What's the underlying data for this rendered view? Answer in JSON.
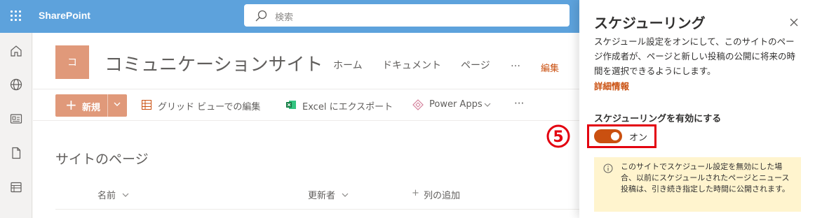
{
  "app": {
    "name": "SharePoint",
    "search_placeholder": "検索"
  },
  "site": {
    "logo_letter": "コ",
    "title": "コミュニケーションサイト",
    "nav": [
      "ホーム",
      "ドキュメント",
      "ページ",
      "…"
    ],
    "edit_label": "編集"
  },
  "commandbar": {
    "new_label": "新規",
    "grid_edit": "グリッド ビューでの編集",
    "excel_export": "Excel にエクスポート",
    "power_apps": "Power Apps",
    "more": "···"
  },
  "list": {
    "heading": "サイトのページ",
    "columns": {
      "name": "名前",
      "modified_by": "更新者",
      "add_column": "列の追加"
    }
  },
  "panel": {
    "title": "スケジューリング",
    "description": "スケジュール設定をオンにして、このサイトのページ作成者が、ページと新しい投稿の公開に将来の時間を選択できるようにします。",
    "link": "詳細情報",
    "toggle_label": "スケジューリングを有効にする",
    "toggle_state": "オン",
    "toggle_on": true,
    "info": "このサイトでスケジュール設定を無効にした場合、以前にスケジュールされたページとニュース投稿は、引き続き指定した時間に公開されます。"
  },
  "annotation": {
    "step": "⑤"
  },
  "colors": {
    "suite_bar": "#5da2dc",
    "accent": "#ca5010",
    "logo": "#e0997a",
    "highlight": "#e3000f",
    "info_background": "#fff4ce"
  }
}
